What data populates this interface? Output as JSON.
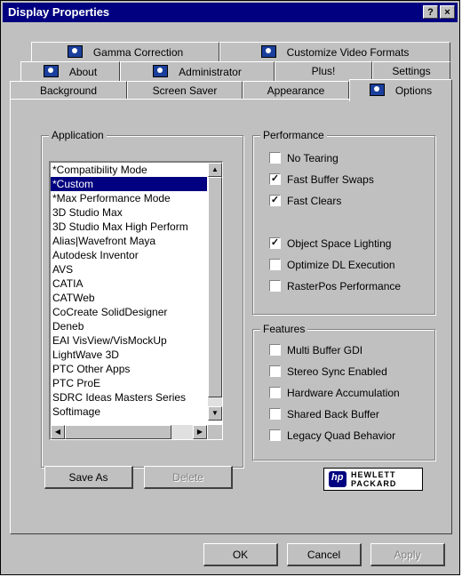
{
  "window": {
    "title": "Display Properties",
    "help_label": "?",
    "close_label": "×"
  },
  "tabs": [
    {
      "label": "Gamma Correction"
    },
    {
      "label": "Customize Video Formats"
    },
    {
      "label": "About"
    },
    {
      "label": "Administrator"
    },
    {
      "label": "Plus!"
    },
    {
      "label": "Settings"
    },
    {
      "label": "Background"
    },
    {
      "label": "Screen Saver"
    },
    {
      "label": "Appearance"
    },
    {
      "label": "Options"
    }
  ],
  "application": {
    "label": "Application",
    "items": [
      "*Compatibility Mode",
      "*Custom",
      "*Max Performance Mode",
      "3D Studio Max",
      "3D Studio Max High Perform",
      "Alias|Wavefront Maya",
      "Autodesk Inventor",
      "AVS",
      "CATIA",
      "CATWeb",
      "CoCreate SolidDesigner",
      "Deneb",
      "EAI VisView/VisMockUp",
      "LightWave 3D",
      "PTC Other Apps",
      "PTC ProE",
      "SDRC Ideas Masters Series",
      "Softimage"
    ],
    "selected": "*Custom",
    "save_as": "Save As",
    "delete": "Delete"
  },
  "performance": {
    "label": "Performance",
    "options": [
      {
        "label": "No Tearing",
        "checked": false
      },
      {
        "label": "Fast Buffer Swaps",
        "checked": true
      },
      {
        "label": "Fast Clears",
        "checked": true
      },
      {
        "label": "Object Space Lighting",
        "checked": true
      },
      {
        "label": "Optimize DL Execution",
        "checked": false
      },
      {
        "label": "RasterPos Performance",
        "checked": false
      }
    ]
  },
  "features": {
    "label": "Features",
    "options": [
      {
        "label": "Multi Buffer GDI",
        "checked": false
      },
      {
        "label": "Stereo Sync Enabled",
        "checked": false
      },
      {
        "label": "Hardware Accumulation",
        "checked": false
      },
      {
        "label": "Shared Back Buffer",
        "checked": false
      },
      {
        "label": "Legacy Quad Behavior",
        "checked": false
      }
    ]
  },
  "logo": {
    "line1": "HEWLETT",
    "line2": "PACKARD"
  },
  "footer": {
    "ok": "OK",
    "cancel": "Cancel",
    "apply": "Apply"
  },
  "colors": {
    "title_bar": "#000080",
    "face": "#c0c0c0",
    "selection": "#000080"
  }
}
